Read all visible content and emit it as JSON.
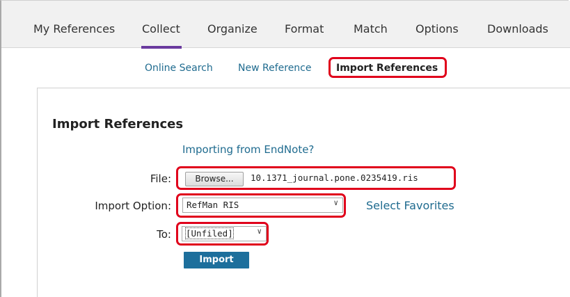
{
  "nav": {
    "tabs": [
      {
        "label": "My References"
      },
      {
        "label": "Collect"
      },
      {
        "label": "Organize"
      },
      {
        "label": "Format"
      },
      {
        "label": "Match"
      },
      {
        "label": "Options"
      },
      {
        "label": "Downloads"
      }
    ],
    "active_tab": "Collect"
  },
  "subnav": {
    "items": [
      {
        "label": "Online Search"
      },
      {
        "label": "New Reference"
      },
      {
        "label": "Import References"
      }
    ],
    "active": "Import References"
  },
  "form": {
    "heading": "Import References",
    "endnote_link": "Importing from EndNote?",
    "file_label": "File:",
    "browse_label": "Browse...",
    "file_name": "10.1371_journal.pone.0235419.ris",
    "import_option_label": "Import Option:",
    "import_option_value": "RefMan RIS",
    "select_favorites_label": "Select Favorites",
    "to_label": "To:",
    "to_value": "[Unfiled]",
    "import_button_label": "Import"
  },
  "colors": {
    "highlight": "#e0001b",
    "link": "#1f6b8f",
    "accent_underline": "#6a3a9e",
    "import_button": "#1d6f9c"
  }
}
